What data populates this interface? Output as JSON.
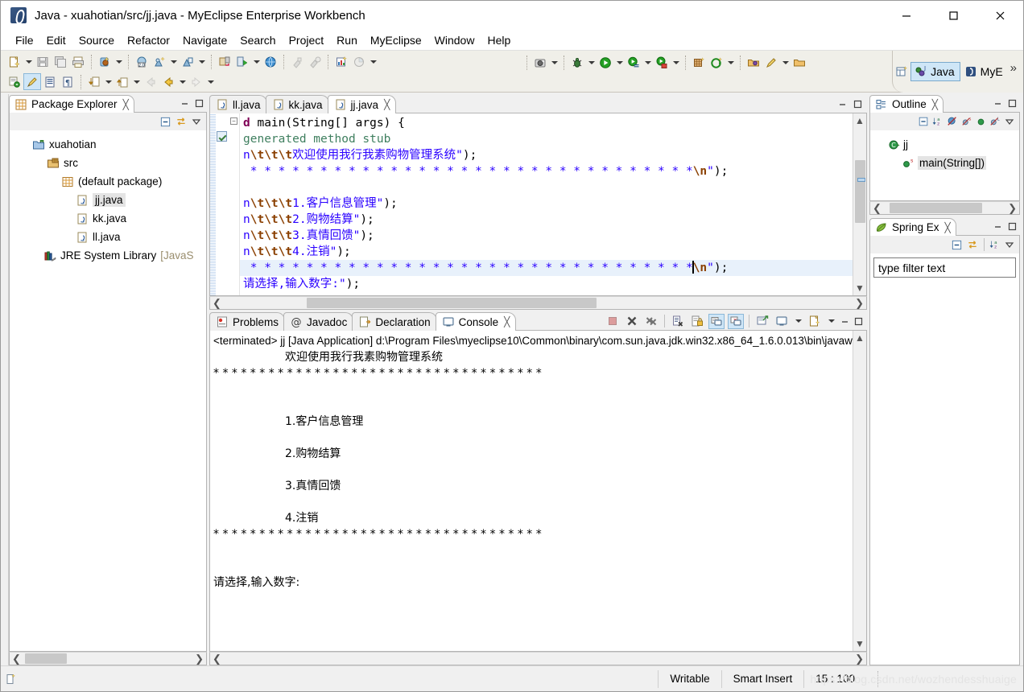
{
  "window": {
    "title": "Java - xuahotian/src/jj.java - MyEclipse Enterprise Workbench",
    "app_icon": "myeclipse-icon",
    "minimize_label": "Minimize",
    "maximize_label": "Maximize",
    "close_label": "Close"
  },
  "menubar": {
    "items": [
      {
        "label": "File"
      },
      {
        "label": "Edit"
      },
      {
        "label": "Source"
      },
      {
        "label": "Refactor"
      },
      {
        "label": "Navigate"
      },
      {
        "label": "Search"
      },
      {
        "label": "Project"
      },
      {
        "label": "Run"
      },
      {
        "label": "MyEclipse"
      },
      {
        "label": "Window"
      },
      {
        "label": "Help"
      }
    ]
  },
  "toolbar": {
    "row1": [
      {
        "icon": "new-wizard-icon",
        "dropdown": true
      },
      {
        "icon": "save-icon",
        "dropdown": false
      },
      {
        "icon": "save-all-icon",
        "dropdown": false
      },
      {
        "icon": "print-icon",
        "dropdown": false
      },
      {
        "sep": true
      },
      {
        "icon": "new-deployment-icon",
        "dropdown": true
      },
      {
        "sep": true
      },
      {
        "icon": "web-browser-2-icon",
        "dropdown": false
      },
      {
        "icon": "db-explorer-new-icon",
        "dropdown": true
      },
      {
        "icon": "db-explorer-icon",
        "dropdown": true
      },
      {
        "sep": true
      },
      {
        "icon": "server-manage-icon",
        "dropdown": false
      },
      {
        "icon": "server-run-icon",
        "dropdown": true
      },
      {
        "icon": "globe-icon",
        "dropdown": false
      },
      {
        "sep": true
      },
      {
        "icon": "build-icon",
        "dropdown": false
      },
      {
        "icon": "build-all-icon",
        "dropdown": false
      },
      {
        "sep": true
      },
      {
        "icon": "report-new-icon",
        "dropdown": false
      },
      {
        "icon": "report-icon",
        "dropdown": true
      }
    ],
    "row2": [
      {
        "icon": "open-type-icon",
        "dropdown": false
      },
      {
        "icon": "highlight-pen-icon",
        "dropdown": false,
        "selected": true
      },
      {
        "icon": "outline-list-icon",
        "dropdown": false
      },
      {
        "icon": "paragraph-icon",
        "dropdown": false
      },
      {
        "sep": true
      },
      {
        "icon": "next-annotation-icon",
        "dropdown": true
      },
      {
        "icon": "previous-annotation-icon",
        "dropdown": true
      },
      {
        "icon": "back-disabled-icon",
        "dropdown": false
      },
      {
        "icon": "back-icon",
        "dropdown": true
      },
      {
        "icon": "forward-icon",
        "dropdown": true
      }
    ],
    "row1_right": [
      {
        "icon": "camera-snapshot-icon",
        "dropdown": true
      },
      {
        "sep": true
      },
      {
        "icon": "debug-icon",
        "dropdown": true
      },
      {
        "icon": "run-icon",
        "dropdown": true
      },
      {
        "icon": "run-config-icon",
        "dropdown": true
      },
      {
        "icon": "run-external-icon",
        "dropdown": true
      },
      {
        "sep": true
      },
      {
        "icon": "new-package-icon",
        "dropdown": false
      },
      {
        "icon": "new-generic-icon",
        "dropdown": true
      },
      {
        "sep": true
      },
      {
        "icon": "open-folder-icon",
        "dropdown": false
      },
      {
        "icon": "pen-icon",
        "dropdown": true
      },
      {
        "icon": "open-folder-2-icon",
        "dropdown": false
      }
    ]
  },
  "perspective": {
    "open_label": "open-perspective-icon",
    "items": [
      {
        "label": "Java",
        "icon": "java-perspective-icon",
        "active": true
      },
      {
        "label": "MyE",
        "icon": "myeclipse-perspective-icon",
        "active": false
      }
    ],
    "more": "»"
  },
  "package_explorer": {
    "tab_label": "Package Explorer",
    "tab_icon": "package-explorer-icon",
    "close_icon": "close-icon",
    "toolbar": [
      {
        "icon": "collapse-all-icon"
      },
      {
        "icon": "link-with-editor-icon"
      },
      {
        "icon": "view-menu-icon"
      }
    ],
    "minimize_icon": "minimize-icon",
    "maximize_icon": "maximize-icon",
    "tree": [
      {
        "label": "xuahotian",
        "icon": "project-icon",
        "indent": 0,
        "selected": false
      },
      {
        "label": "src",
        "icon": "source-folder-icon",
        "indent": 1,
        "selected": false
      },
      {
        "label": "(default package)",
        "icon": "package-icon",
        "indent": 2,
        "selected": false
      },
      {
        "label": "jj.java",
        "icon": "java-file-icon",
        "indent": 3,
        "selected": true
      },
      {
        "label": "kk.java",
        "icon": "java-file-icon",
        "indent": 3,
        "selected": false
      },
      {
        "label": "ll.java",
        "icon": "java-file-icon",
        "indent": 3,
        "selected": false
      },
      {
        "label": "JRE System Library",
        "label2": "[JavaS",
        "icon": "library-icon",
        "indent": 1,
        "selected": false
      }
    ],
    "scroll_left_icon": "scroll-left-icon",
    "scroll_right_icon": "scroll-right-icon"
  },
  "editor": {
    "tabs": [
      {
        "label": "ll.java",
        "icon": "java-file-icon",
        "active": false,
        "closable": false
      },
      {
        "label": "kk.java",
        "icon": "java-file-icon",
        "active": false,
        "closable": false
      },
      {
        "label": "jj.java",
        "icon": "java-file-icon",
        "active": true,
        "closable": true
      }
    ],
    "close_icon": "close-icon",
    "minimize_icon": "minimize-icon",
    "maximize_icon": "maximize-icon",
    "code_lines": [
      {
        "hl": false,
        "tokens": [
          {
            "t": "d ",
            "c": "kw"
          },
          {
            "t": "main(String[] args) {",
            "c": "plain"
          }
        ]
      },
      {
        "hl": false,
        "tokens": [
          {
            "t": "generated method stub",
            "c": "cmt"
          }
        ]
      },
      {
        "hl": false,
        "tokens": [
          {
            "t": "n",
            "c": "str"
          },
          {
            "t": "\\t\\t\\t",
            "c": "esc"
          },
          {
            "t": "欢迎使用我行我素购物管理系统\"",
            "c": "str"
          },
          {
            "t": ");",
            "c": "plain"
          }
        ]
      },
      {
        "hl": false,
        "tokens": [
          {
            "t": " * * * * * * * * * * * * * * * * * * * * * * * * * * * * * * * *",
            "c": "str"
          },
          {
            "t": "\\n",
            "c": "esc"
          },
          {
            "t": "\"",
            "c": "str"
          },
          {
            "t": ");",
            "c": "plain"
          }
        ]
      },
      {
        "hl": false,
        "tokens": []
      },
      {
        "hl": false,
        "tokens": [
          {
            "t": "n",
            "c": "str"
          },
          {
            "t": "\\t\\t\\t",
            "c": "esc"
          },
          {
            "t": "1.客户信息管理\"",
            "c": "str"
          },
          {
            "t": ");",
            "c": "plain"
          }
        ]
      },
      {
        "hl": false,
        "tokens": [
          {
            "t": "n",
            "c": "str"
          },
          {
            "t": "\\t\\t\\t",
            "c": "esc"
          },
          {
            "t": "2.购物结算\"",
            "c": "str"
          },
          {
            "t": ");",
            "c": "plain"
          }
        ]
      },
      {
        "hl": false,
        "tokens": [
          {
            "t": "n",
            "c": "str"
          },
          {
            "t": "\\t\\t\\t",
            "c": "esc"
          },
          {
            "t": "3.真情回馈\"",
            "c": "str"
          },
          {
            "t": ");",
            "c": "plain"
          }
        ]
      },
      {
        "hl": false,
        "tokens": [
          {
            "t": "n",
            "c": "str"
          },
          {
            "t": "\\t\\t\\t",
            "c": "esc"
          },
          {
            "t": "4.注销\"",
            "c": "str"
          },
          {
            "t": ");",
            "c": "plain"
          }
        ]
      },
      {
        "hl": true,
        "caret_before_last": true,
        "tokens": [
          {
            "t": " * * * * * * * * * * * * * * * * * * * * * * * * * * * * * * * *",
            "c": "str"
          },
          {
            "t": "\\n",
            "c": "esc"
          },
          {
            "t": "\"",
            "c": "str"
          },
          {
            "t": ");",
            "c": "plain"
          }
        ]
      },
      {
        "hl": false,
        "tokens": [
          {
            "t": "请选择,输入数字:\"",
            "c": "str"
          },
          {
            "t": ");",
            "c": "plain"
          }
        ]
      }
    ],
    "scroll_left_icon": "scroll-left-icon",
    "scroll_right_icon": "scroll-right-icon",
    "scroll_up_icon": "scroll-up-icon",
    "scroll_down_icon": "scroll-down-icon"
  },
  "console": {
    "tabs": [
      {
        "label": "Problems",
        "icon": "problems-icon",
        "active": false,
        "closable": false
      },
      {
        "label": "Javadoc",
        "icon": "javadoc-icon",
        "active": false,
        "closable": false
      },
      {
        "label": "Declaration",
        "icon": "declaration-icon",
        "active": false,
        "closable": false
      },
      {
        "label": "Console",
        "icon": "console-icon",
        "active": true,
        "closable": true
      }
    ],
    "close_icon": "close-icon",
    "toolbar": [
      {
        "icon": "terminate-icon",
        "selected": false
      },
      {
        "icon": "remove-launch-icon",
        "selected": false
      },
      {
        "icon": "remove-all-launches-icon",
        "selected": false
      },
      {
        "sep": true
      },
      {
        "icon": "clear-console-icon",
        "selected": false
      },
      {
        "icon": "scroll-lock-icon",
        "selected": false
      },
      {
        "icon": "show-console-on-output-icon",
        "selected": true
      },
      {
        "icon": "show-console-on-error-icon",
        "selected": true
      },
      {
        "sep": true
      },
      {
        "icon": "pin-console-icon",
        "selected": false
      },
      {
        "icon": "display-selected-console-icon",
        "dropdown": true
      },
      {
        "icon": "open-console-icon",
        "dropdown": true
      }
    ],
    "minimize_icon": "minimize-icon",
    "maximize_icon": "maximize-icon",
    "launch_line": "<terminated> jj [Java Application] d:\\Program Files\\myeclipse10\\Common\\binary\\com.sun.java.jdk.win32.x86_64_1.6.0.013\\bin\\javaw.exe (",
    "output_lines": [
      "                    欢迎使用我行我素购物管理系统",
      "* * * * * * * * * * * * * * * * * * * * * * * * * * * * * * * * * * * *",
      "",
      "",
      "                    1.客户信息管理",
      "",
      "                    2.购物结算",
      "",
      "                    3.真情回馈",
      "",
      "                    4.注销",
      "* * * * * * * * * * * * * * * * * * * * * * * * * * * * * * * * * * * *",
      "",
      "请选择,输入数字:"
    ],
    "scroll_up_icon": "scroll-up-icon",
    "scroll_down_icon": "scroll-down-icon",
    "scroll_left_icon": "scroll-left-icon",
    "scroll_right_icon": "scroll-right-icon"
  },
  "outline": {
    "tab_label": "Outline",
    "tab_icon": "outline-icon",
    "close_icon": "close-icon",
    "toolbar": [
      {
        "icon": "collapse-all-icon"
      },
      {
        "icon": "sort-icon"
      },
      {
        "icon": "hide-non-public-icon"
      },
      {
        "icon": "hide-static-icon"
      },
      {
        "icon": "hide-fields-icon"
      },
      {
        "icon": "hide-local-types-icon"
      },
      {
        "icon": "view-menu-icon"
      }
    ],
    "minimize_icon": "minimize-icon",
    "maximize_icon": "maximize-icon",
    "tree": [
      {
        "label": "jj",
        "icon": "class-icon",
        "indent": 0,
        "selected": false
      },
      {
        "label": "main(String[])",
        "icon": "method-static-icon",
        "indent": 1,
        "selected": true
      }
    ],
    "scroll_left_icon": "scroll-left-icon",
    "scroll_right_icon": "scroll-right-icon"
  },
  "spring_explorer": {
    "tab_label": "Spring Ex",
    "tab_icon": "spring-leaf-icon",
    "close_icon": "close-icon",
    "toolbar": [
      {
        "icon": "collapse-all-icon"
      },
      {
        "icon": "link-with-editor-icon"
      },
      {
        "icon": "sort-icon"
      },
      {
        "icon": "view-menu-icon"
      }
    ],
    "minimize_icon": "minimize-icon",
    "maximize_icon": "maximize-icon",
    "filter_placeholder": "type filter text",
    "filter_value": "type filter text"
  },
  "statusbar": {
    "icon": "writable-doc-icon",
    "writable": "Writable",
    "insert_mode": "Smart Insert",
    "position": "15 : 100",
    "watermark": "https://blog.csdn.net/wozhendesshuaige"
  },
  "colors": {
    "accent": "#cfe6f7",
    "tab_active_bg": "#ffffff",
    "string": "#2a00ff",
    "comment": "#3f7f5f",
    "keyword": "#7f0055",
    "escape": "#8a3f00",
    "selection_line": "#e8f1fb",
    "panel_bg": "#f0f0f0"
  }
}
